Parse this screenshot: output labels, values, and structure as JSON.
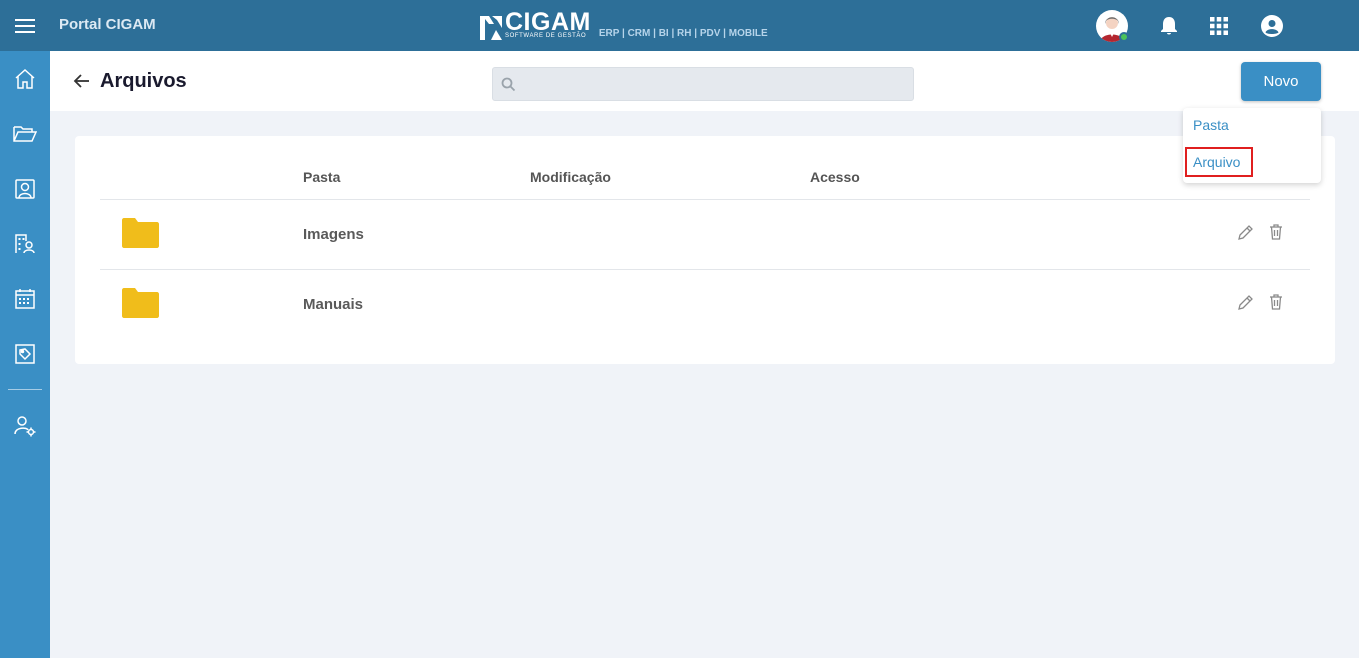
{
  "topbar": {
    "portal_title": "Portal CIGAM",
    "logo_name": "CIGAM",
    "logo_sub": "SOFTWARE DE GESTÃO",
    "logo_modules": "ERP | CRM | BI | RH | PDV | MOBILE",
    "user_status": "online",
    "icons": [
      "bell-icon",
      "apps-grid-icon",
      "account-circle-icon"
    ]
  },
  "sidebar": {
    "items": [
      "home-icon",
      "folder-icon",
      "contacts-icon",
      "org-users-icon",
      "calendar-icon",
      "tags-icon",
      "user-settings-icon"
    ]
  },
  "header": {
    "title": "Arquivos",
    "search_placeholder": "",
    "new_button": "Novo"
  },
  "dropdown": {
    "options": [
      "Pasta",
      "Arquivo"
    ],
    "highlighted": "Arquivo"
  },
  "table": {
    "columns": [
      "Pasta",
      "Modificação",
      "Acesso"
    ],
    "rows": [
      {
        "name": "Imagens",
        "modified": "",
        "access": ""
      },
      {
        "name": "Manuais",
        "modified": "",
        "access": ""
      }
    ]
  },
  "colors": {
    "topbar": "#2d6f98",
    "sidebar": "#3a8fc5",
    "accent": "#3a8fc5",
    "folder": "#f0bd1b",
    "highlight_border": "#e01f1f",
    "background": "#f0f3f8"
  }
}
